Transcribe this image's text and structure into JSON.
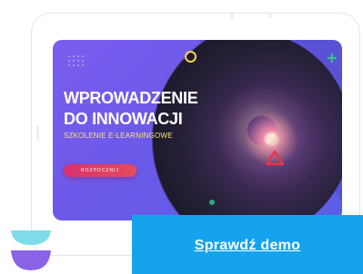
{
  "slide": {
    "title_line1": "WPROWADZENIE",
    "title_line2": "DO INNOWACJI",
    "subtitle": "SZKOLENIE E-LEARNINGOWE",
    "start_button": "ROZPOCZNIJ"
  },
  "cta": {
    "label": "Sprawdź demo"
  },
  "colors": {
    "screen_bg": "#6a5ae8",
    "cta_bg": "#16a3ee",
    "start_button": "#d6326e",
    "subtitle": "#ffe07a",
    "accent_green": "#2fd27a",
    "accent_yellow": "#f6d24a",
    "accent_red": "#e8344a",
    "logo_top": "#7fdbe8",
    "logo_bottom": "#8a63e6"
  },
  "icons": [
    "circle-ring-icon",
    "plus-icon",
    "triangle-icon",
    "brand-logo-icon"
  ]
}
